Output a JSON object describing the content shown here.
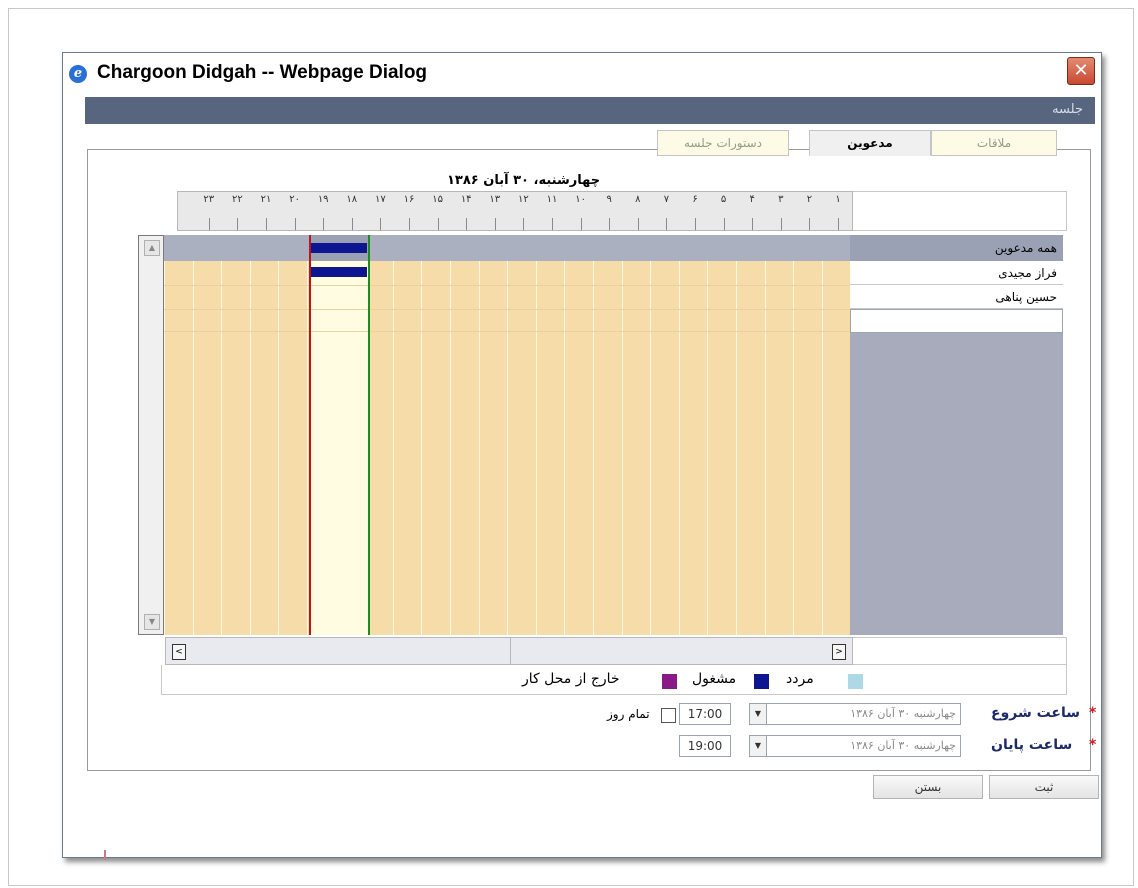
{
  "window": {
    "title": "Chargoon Didgah -- Webpage Dialog",
    "ie_icon": "e",
    "close_glyph": "✕"
  },
  "header": {
    "title": "جلسه"
  },
  "tabs": [
    {
      "label": "ملاقات",
      "active": false
    },
    {
      "label": "مدعوین",
      "active": true
    },
    {
      "label": "دستورات جلسه",
      "active": false
    }
  ],
  "schedule": {
    "date_label": "چهارشنبه، ۳۰ آبان ۱۳۸۶",
    "hours": [
      "۱",
      "۲",
      "۳",
      "۴",
      "۵",
      "۶",
      "۷",
      "۸",
      "۹",
      "۱۰",
      "۱۱",
      "۱۲",
      "۱۳",
      "۱۴",
      "۱۵",
      "۱۶",
      "۱۷",
      "۱۸",
      "۱۹",
      "۲۰",
      "۲۱",
      "۲۲",
      "۲۳"
    ],
    "all_invitees_label": "همه مدعوین",
    "invitees": [
      "فراز مجیدی",
      "حسین پناهی"
    ],
    "selected_start": "17:00",
    "selected_end": "19:00"
  },
  "legend": [
    {
      "label": "مردد",
      "color": "#add8e6"
    },
    {
      "label": "مشغول",
      "color": "#0c1690"
    },
    {
      "label": "خارج از محل کار",
      "color": "#8a1a8a"
    }
  ],
  "form": {
    "start_label": "ساعت شروع",
    "start_date": "چهارشنبه ۳۰ آبان ۱۳۸۶",
    "start_time": "17:00",
    "all_day_label": "تمام روز",
    "all_day_checked": false,
    "end_label": "ساعت پایان",
    "end_date": "چهارشنبه ۳۰ آبان ۱۳۸۶",
    "end_time": "19:00",
    "required_mark": "*"
  },
  "buttons": {
    "submit": "ثبت",
    "close": "بستن"
  },
  "colors": {
    "header_band": "#57657f",
    "timeline_bg": "#f6dca8",
    "free_slot": "#fffce2",
    "busy": "#0c1690",
    "start_line": "#c21414",
    "end_line": "#1f8a1f"
  }
}
